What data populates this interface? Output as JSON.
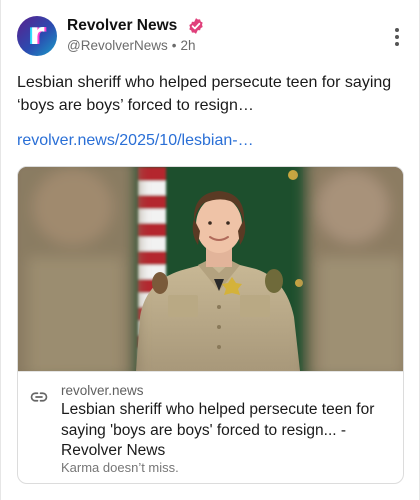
{
  "post": {
    "author": {
      "display_name": "Revolver News",
      "handle": "@RevolverNews",
      "time": "2h",
      "avatar_letter": "r",
      "verified": true,
      "verified_color": "#e0407b"
    },
    "more_icon": "vertical-dots-icon",
    "text": "Lesbian sheriff who helped persecute teen for saying ‘boys are boys’ forced to resign…",
    "link_text": "revolver.news/2025/10/lesbian-…",
    "link_color": "#2a6fd6",
    "embed": {
      "domain": "revolver.news",
      "title": "Lesbian sheriff who helped persecute teen for saying 'boys are boys' forced to resign... - Revolver News",
      "description": "Karma doesn’t miss.",
      "link_icon": "link-icon"
    }
  }
}
